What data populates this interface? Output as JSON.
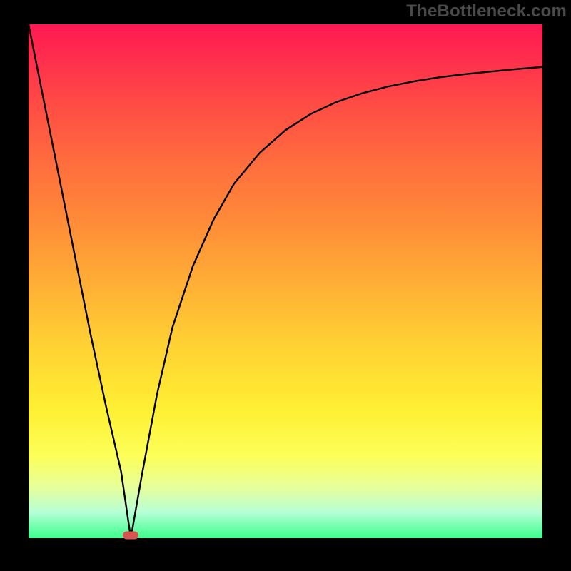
{
  "watermark": "TheBottleneck.com",
  "chart_data": {
    "type": "line",
    "x": [
      0.0,
      0.03,
      0.06,
      0.09,
      0.12,
      0.15,
      0.18,
      0.199,
      0.22,
      0.25,
      0.28,
      0.32,
      0.36,
      0.4,
      0.45,
      0.5,
      0.55,
      0.6,
      0.65,
      0.7,
      0.75,
      0.8,
      0.85,
      0.9,
      0.95,
      1.0
    ],
    "values": [
      100.0,
      85.0,
      70.0,
      55.0,
      40.0,
      26.0,
      13.0,
      0.0,
      12.0,
      28.0,
      41.0,
      53.0,
      62.0,
      69.0,
      75.0,
      79.4,
      82.6,
      84.9,
      86.6,
      87.9,
      88.9,
      89.7,
      90.3,
      90.8,
      91.3,
      91.7
    ],
    "xlim": [
      0,
      1
    ],
    "ylim": [
      0,
      100
    ],
    "xlabel": "",
    "ylabel": "",
    "title": "",
    "background": "red-to-green vertical gradient inside black frame",
    "vertex_x": 0.199,
    "marker": {
      "x_norm": 0.199,
      "y_norm": 0.0
    }
  }
}
